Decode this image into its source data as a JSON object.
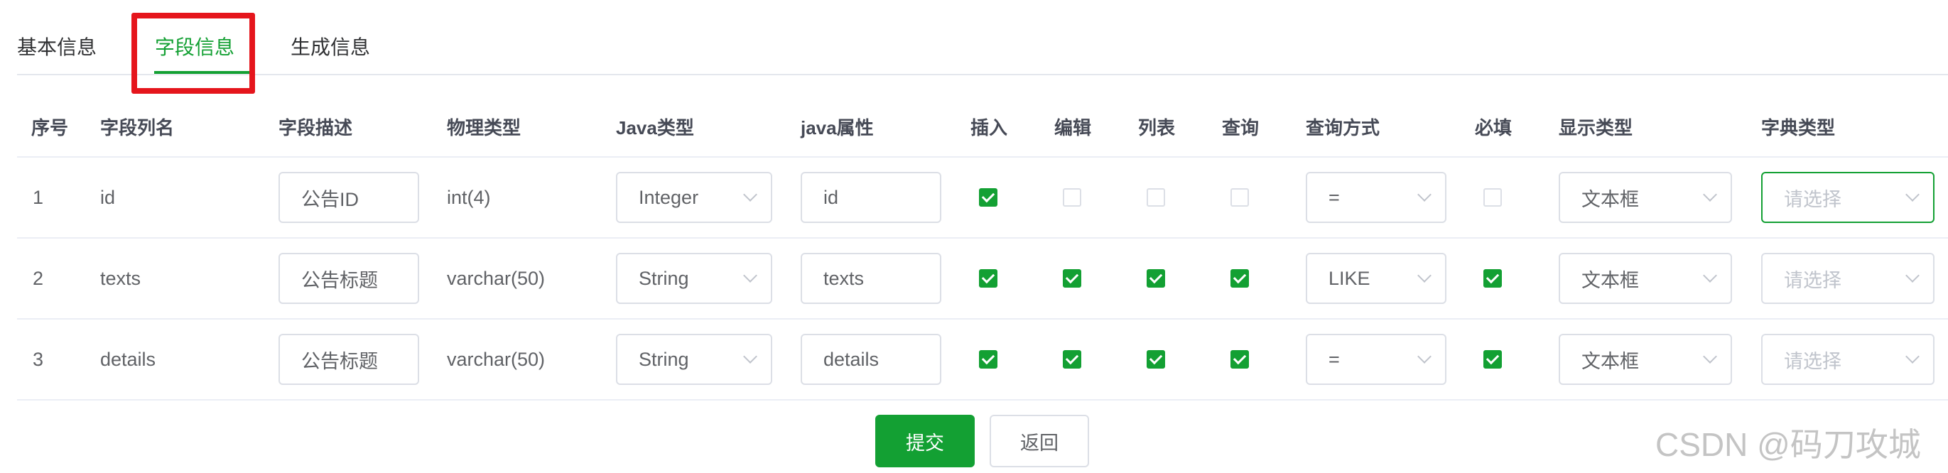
{
  "tabs": [
    {
      "label": "基本信息",
      "active": false
    },
    {
      "label": "字段信息",
      "active": true
    },
    {
      "label": "生成信息",
      "active": false
    }
  ],
  "table": {
    "headers": [
      "序号",
      "字段列名",
      "字段描述",
      "物理类型",
      "Java类型",
      "java属性",
      "插入",
      "编辑",
      "列表",
      "查询",
      "查询方式",
      "必填",
      "显示类型",
      "字典类型"
    ],
    "rows": [
      {
        "index": "1",
        "column": "id",
        "description": "公告ID",
        "physical_type": "int(4)",
        "java_type": "Integer",
        "java_field": "id",
        "insert": true,
        "edit": false,
        "list": false,
        "query": false,
        "query_type": "=",
        "required": false,
        "html_type": "文本框",
        "dict_type": "请选择"
      },
      {
        "index": "2",
        "column": "texts",
        "description": "公告标题",
        "physical_type": "varchar(50)",
        "java_type": "String",
        "java_field": "texts",
        "insert": true,
        "edit": true,
        "list": true,
        "query": true,
        "query_type": "LIKE",
        "required": true,
        "html_type": "文本框",
        "dict_type": "请选择"
      },
      {
        "index": "3",
        "column": "details",
        "description": "公告标题",
        "physical_type": "varchar(50)",
        "java_type": "String",
        "java_field": "details",
        "insert": true,
        "edit": true,
        "list": true,
        "query": true,
        "query_type": "=",
        "required": true,
        "html_type": "文本框",
        "dict_type": "请选择"
      }
    ]
  },
  "buttons": {
    "submit": "提交",
    "back": "返回"
  },
  "watermark": "CSDN @码刀攻城",
  "colors": {
    "accent": "#13a033",
    "highlight": "#e5151c"
  }
}
